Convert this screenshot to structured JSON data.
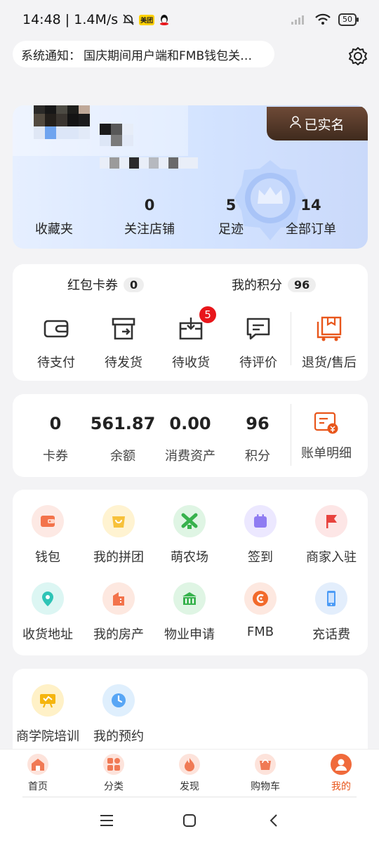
{
  "status_bar": {
    "time_speed": "14:48 | 1.4M/s",
    "meituan_badge": "美团",
    "battery": "50"
  },
  "notice": {
    "label": "系统通知：",
    "text": "国庆期间用户端和FMB钱包关…"
  },
  "profile": {
    "verified_label": "已实名",
    "stats": [
      {
        "num": "",
        "label": "收藏夹"
      },
      {
        "num": "0",
        "label": "关注店铺"
      },
      {
        "num": "5",
        "label": "足迹"
      },
      {
        "num": "14",
        "label": "全部订单"
      }
    ]
  },
  "orders": {
    "coupon_label": "红包卡券",
    "coupon_count": "0",
    "points_label": "我的积分",
    "points_count": "96",
    "items": [
      {
        "label": "待支付",
        "icon": "wallet-icon"
      },
      {
        "label": "待发货",
        "icon": "box-out-icon"
      },
      {
        "label": "待收货",
        "icon": "package-icon",
        "badge": "5"
      },
      {
        "label": "待评价",
        "icon": "comment-icon"
      },
      {
        "label": "退货/售后",
        "icon": "return-icon"
      }
    ]
  },
  "assets": {
    "items": [
      {
        "num": "0",
        "label": "卡券"
      },
      {
        "num": "561.87",
        "label": "余额"
      },
      {
        "num": "0.00",
        "label": "消费资产"
      },
      {
        "num": "96",
        "label": "积分"
      }
    ],
    "bill_label": "账单明细"
  },
  "services": [
    {
      "label": "钱包",
      "icon": "wallet-icon"
    },
    {
      "label": "我的拼团",
      "icon": "shopping-bag-icon"
    },
    {
      "label": "萌农场",
      "icon": "windmill-icon"
    },
    {
      "label": "签到",
      "icon": "calendar-icon"
    },
    {
      "label": "商家入驻",
      "icon": "flag-icon"
    },
    {
      "label": "收货地址",
      "icon": "location-icon"
    },
    {
      "label": "我的房产",
      "icon": "building-icon"
    },
    {
      "label": "物业申请",
      "icon": "bank-icon"
    },
    {
      "label": "FMB",
      "icon": "fmb-coin-icon"
    },
    {
      "label": "充话费",
      "icon": "phone-icon"
    }
  ],
  "extra": [
    {
      "label": "商学院培训",
      "icon": "training-board-icon"
    },
    {
      "label": "我的预约",
      "icon": "clock-icon"
    }
  ],
  "tabs": [
    {
      "label": "首页",
      "icon": "home-icon"
    },
    {
      "label": "分类",
      "icon": "category-icon"
    },
    {
      "label": "发现",
      "icon": "fire-icon"
    },
    {
      "label": "购物车",
      "icon": "cart-icon"
    },
    {
      "label": "我的",
      "icon": "user-icon",
      "active": true
    }
  ],
  "colors": {
    "accent": "#e8561b",
    "badge_red": "#e8161b",
    "verify_brown": "#4f3424"
  }
}
